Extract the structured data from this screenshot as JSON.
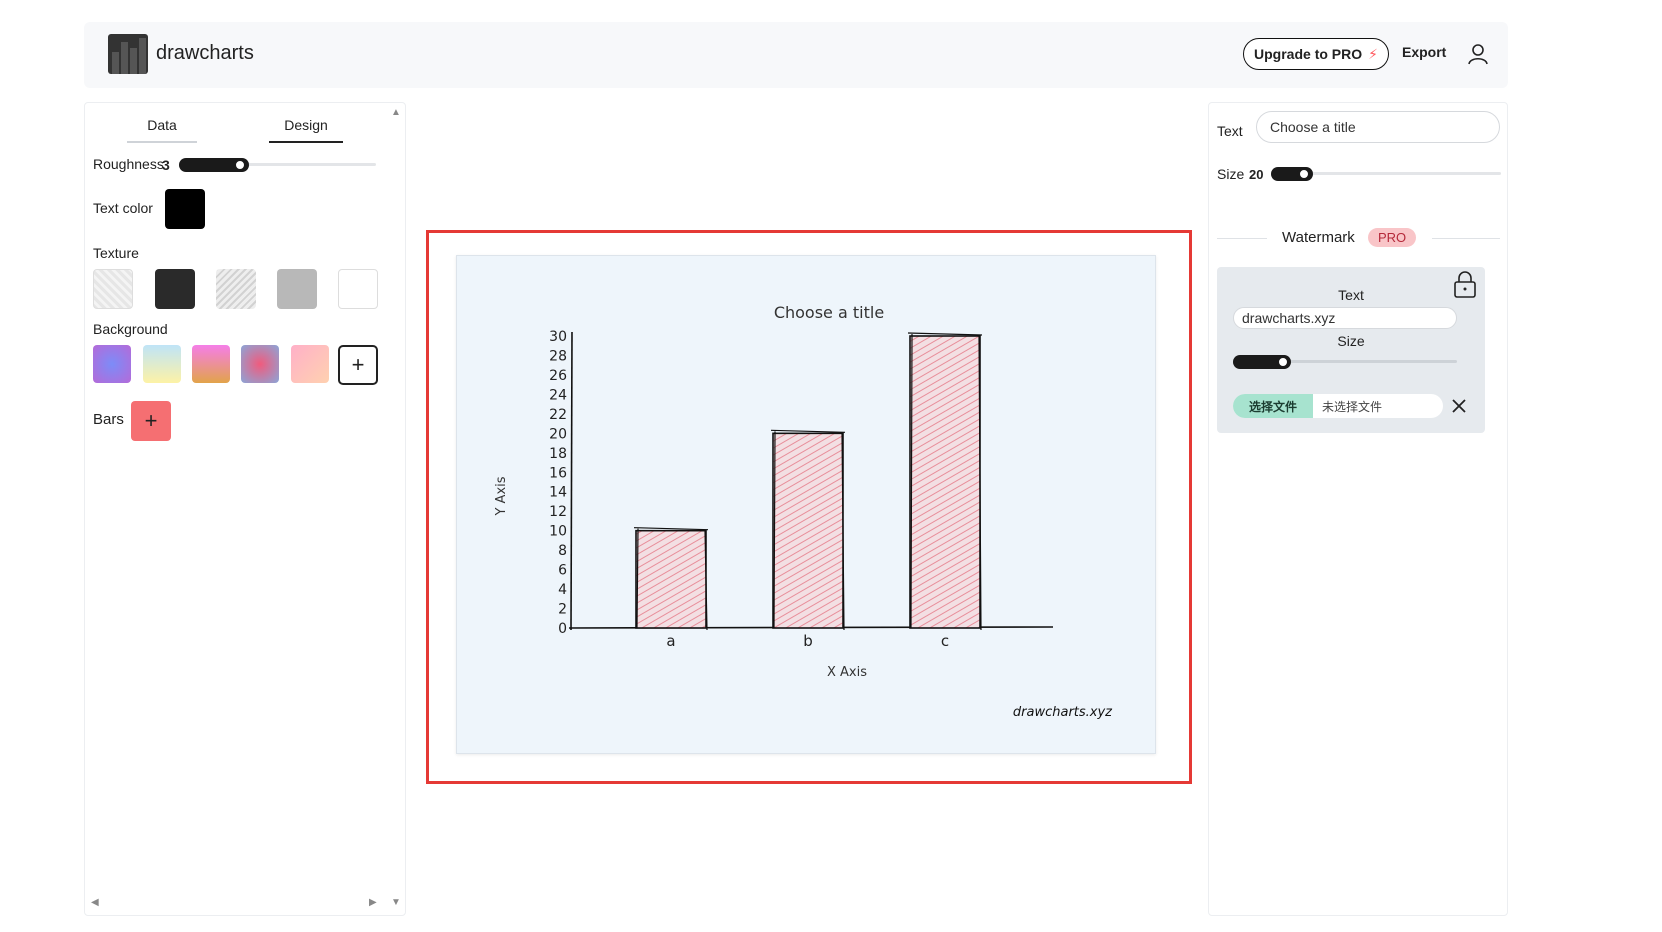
{
  "header": {
    "brand": "drawcharts",
    "upgrade_label": "Upgrade to PRO",
    "export_label": "Export"
  },
  "left_panel": {
    "tabs": [
      {
        "label": "Data"
      },
      {
        "label": "Design"
      }
    ],
    "active_tab": "Design",
    "roughness_label": "Roughness",
    "roughness_value": "3",
    "text_color_label": "Text color",
    "text_color": "#000000",
    "texture_label": "Texture",
    "background_label": "Background",
    "bars_label": "Bars"
  },
  "right_panel": {
    "text_label": "Text",
    "title_value": "Choose a title",
    "size_label": "Size",
    "size_value": "20",
    "watermark_label": "Watermark",
    "pro_badge": "PRO",
    "wm_text_label": "Text",
    "wm_text_value": "drawcharts.xyz",
    "wm_size_label": "Size",
    "file_button": "选择文件",
    "file_status": "未选择文件"
  },
  "chart_data": {
    "type": "bar",
    "title": "Choose a title",
    "xlabel": "X Axis",
    "ylabel": "Y Axis",
    "categories": [
      "a",
      "b",
      "c"
    ],
    "values": [
      10,
      20,
      30
    ],
    "ylim": [
      0,
      30
    ],
    "yticks": [
      "0",
      "2",
      "4",
      "6",
      "8",
      "10",
      "12",
      "14",
      "16",
      "18",
      "20",
      "22",
      "24",
      "26",
      "28",
      "30"
    ],
    "bar_fill": "#e88e9a",
    "watermark": "drawcharts.xyz"
  }
}
